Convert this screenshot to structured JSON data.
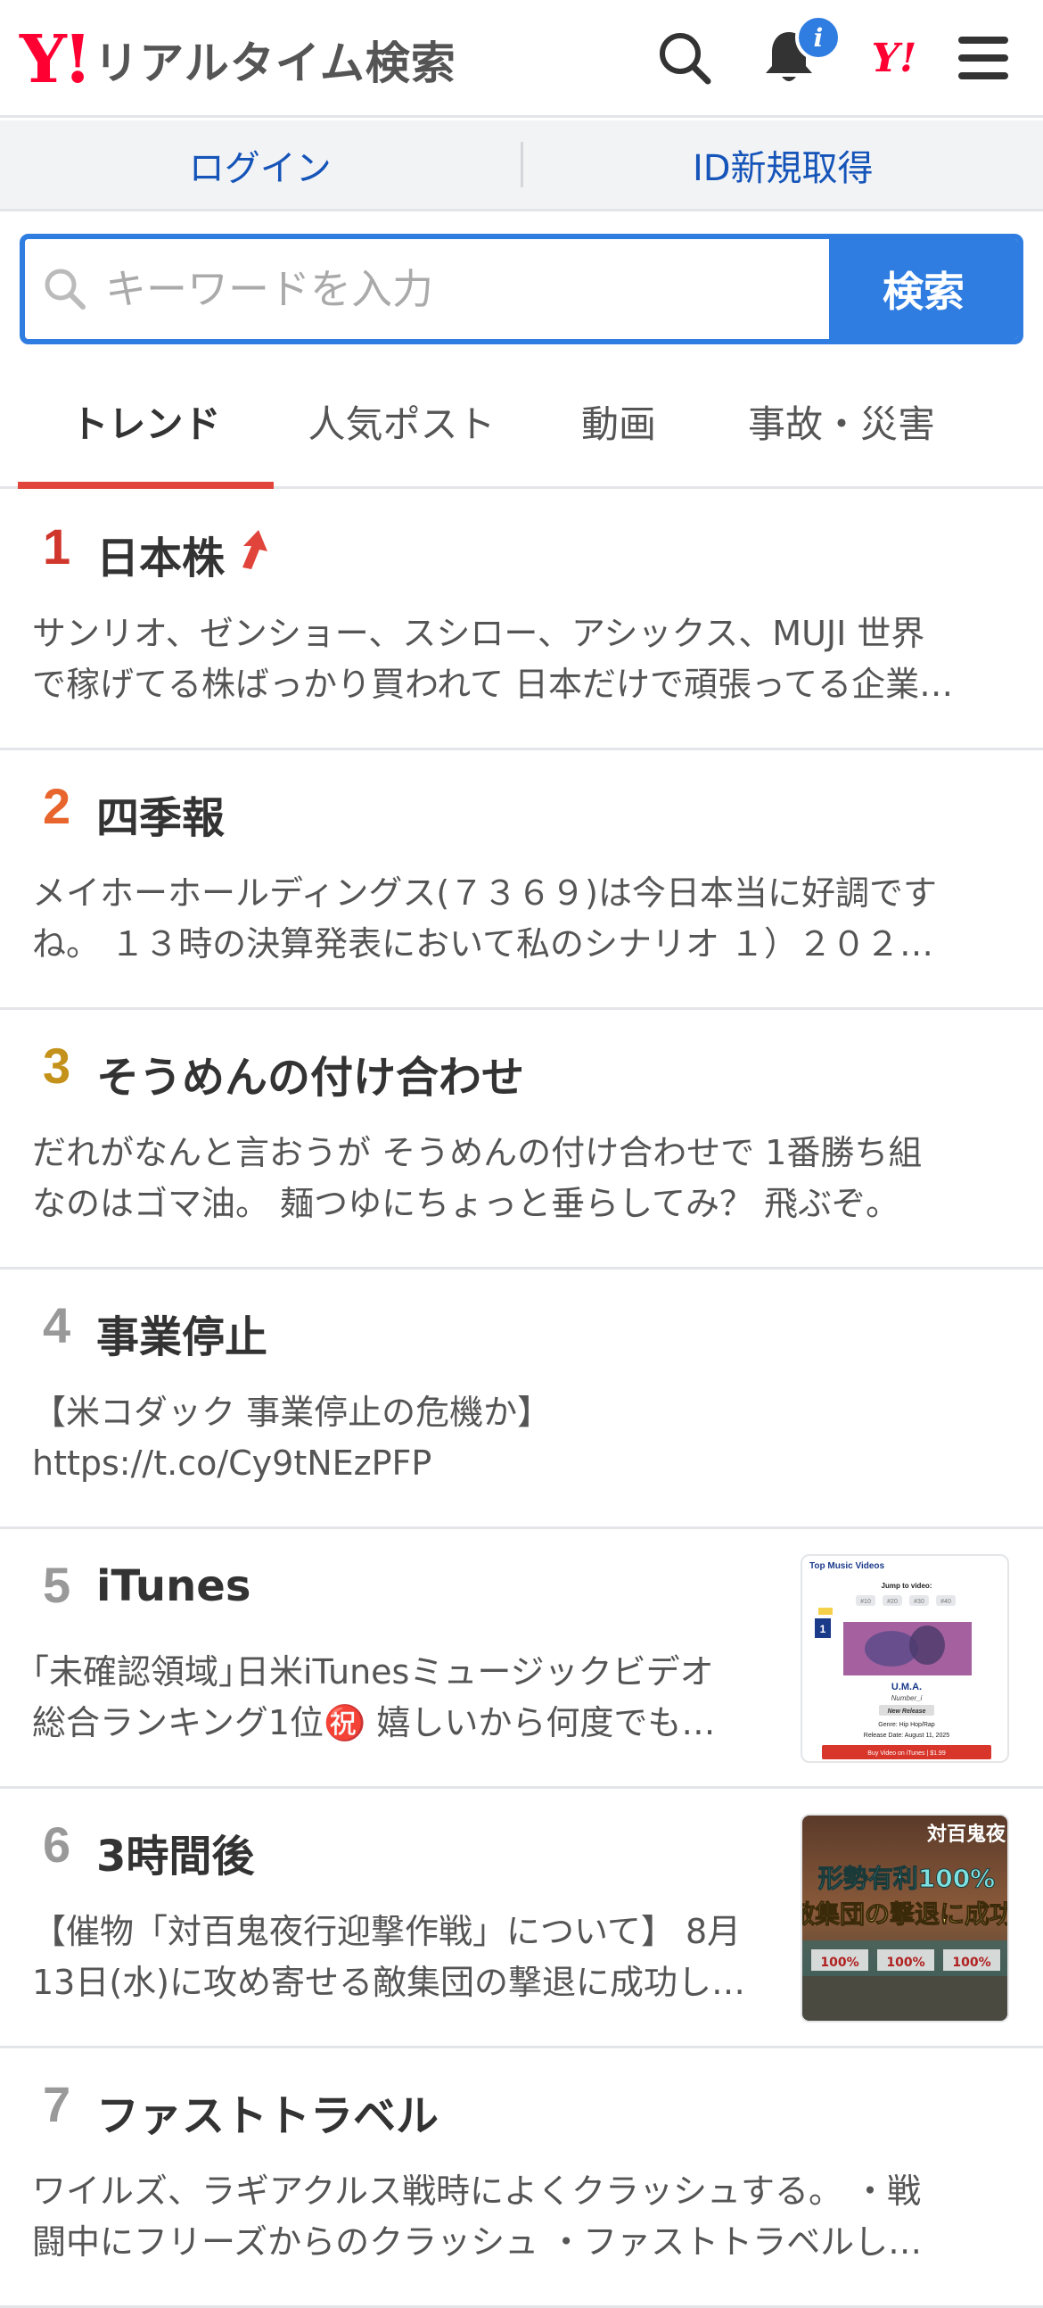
{
  "header": {
    "logo_mark": "Y!",
    "logo_text": "リアルタイム検索",
    "notification_badge": "i",
    "yahoo_mark": "Y!"
  },
  "login_bar": {
    "login_label": "ログイン",
    "register_label": "ID新規取得"
  },
  "search": {
    "placeholder": "キーワードを入力",
    "button_label": "検索"
  },
  "tabs": [
    {
      "label": "トレンド",
      "active": true
    },
    {
      "label": "人気ポスト",
      "active": false
    },
    {
      "label": "動画",
      "active": false
    },
    {
      "label": "事故・災害",
      "active": false
    }
  ],
  "colors": {
    "rank1": "#d0362b",
    "rank2": "#e8652d",
    "rank3": "#c4921a",
    "rank_other": "#999999",
    "accent_blue": "#2f7de1",
    "tab_underline": "#e0443a"
  },
  "trends": [
    {
      "rank": "1",
      "title": "日本株",
      "rising": true,
      "line1": "サンリオ、ゼンショー、スシロー、アシックス、MUJI 世界",
      "line2": "で稼げてる株ばっかり買われて 日本だけで頑張ってる企業…"
    },
    {
      "rank": "2",
      "title": "四季報",
      "line1": "メイホーホールディングス(７３６９)は今日本当に好調です",
      "line2": "ね。 １３時の決算発表において私のシナリオ １）２０２…"
    },
    {
      "rank": "3",
      "title": "そうめんの付け合わせ",
      "line1": "だれがなんと言おうが そうめんの付け合わせで 1番勝ち組",
      "line2": "なのはゴマ油。 麺つゆにちょっと垂らしてみ？ 飛ぶぞ。"
    },
    {
      "rank": "4",
      "title": "事業停止",
      "line1": "【米コダック 事業停止の危機か】",
      "line2": "https://t.co/Cy9tNEzPFP"
    },
    {
      "rank": "5",
      "title": "iTunes",
      "line1": "｢未確認領域｣日米iTunesミュージックビデオ",
      "line2": "総合ランキング1位㊗️ 嬉しいから何度でも…",
      "thumb": {
        "heading": "Top Music Videos",
        "jump_label": "Jump to video:",
        "pills": [
          "#10",
          "#20",
          "#30",
          "#40"
        ],
        "badge": "1",
        "song": "U.M.A.",
        "artist": "Number_i",
        "tag": "New Release",
        "genre": "Genre: Hip Hop/Rap",
        "release": "Release Date: August 11, 2025",
        "buy": "Buy Video on iTunes | $1.99"
      }
    },
    {
      "rank": "6",
      "title": "3時間後",
      "line1": "【催物「対百鬼夜行迎撃作戦」について】 8月",
      "line2": "13日(水)に攻め寄せる敵集団の撃退に成功し…",
      "thumb": {
        "corner_text": "対百鬼夜",
        "headline1": "形勢有利100%",
        "headline2": "敵集団の撃退に成功",
        "gauge": "100%"
      }
    },
    {
      "rank": "7",
      "title": "ファストトラベル",
      "line1": "ワイルズ、ラギアクルス戦時によくクラッシュする。 ・戦",
      "line2": "闘中にフリーズからのクラッシュ ・ファストトラベルし…"
    }
  ]
}
